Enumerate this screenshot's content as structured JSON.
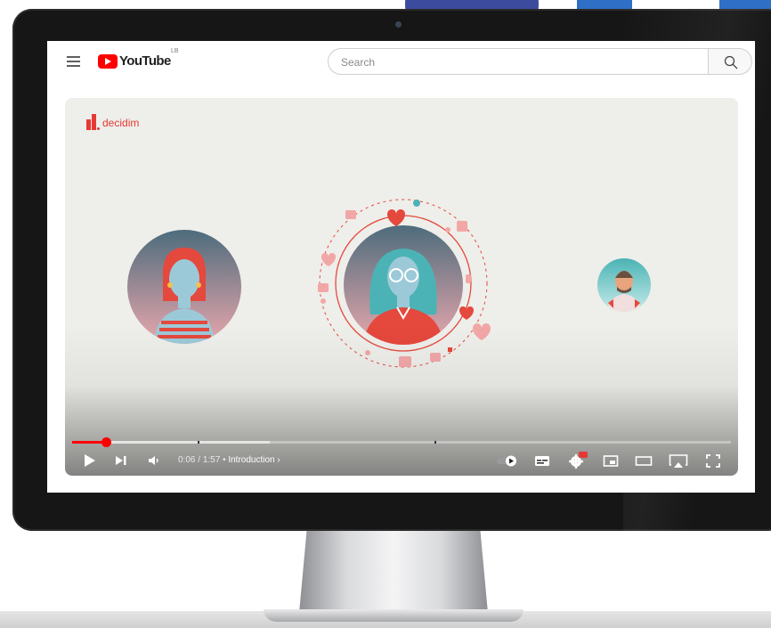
{
  "header": {
    "menu_icon": "hamburger-menu-icon",
    "logo_text": "YouTube",
    "region_code": "LB",
    "search_placeholder": "Search",
    "search_icon": "search-icon"
  },
  "video": {
    "brand_text": "decidim",
    "current_time": "0:06",
    "duration": "1:57",
    "chapter": "Introduction",
    "progress_fraction": 0.051,
    "buffered_fraction": 0.3,
    "chapter_marks": [
      0.19,
      0.55
    ]
  },
  "controls": {
    "play": "play-icon",
    "next": "next-icon",
    "volume": "volume-icon",
    "autoplay": "autoplay-toggle-icon",
    "captions": "captions-icon",
    "settings": "settings-gear-icon",
    "settings_badge": "HD",
    "miniplayer": "miniplayer-icon",
    "theater": "theater-mode-icon",
    "airplay": "airplay-icon",
    "fullscreen": "fullscreen-icon"
  },
  "colors": {
    "youtube_red": "#ff0000",
    "decidim_red": "#e53935",
    "monitor_bezel": "#161616"
  }
}
